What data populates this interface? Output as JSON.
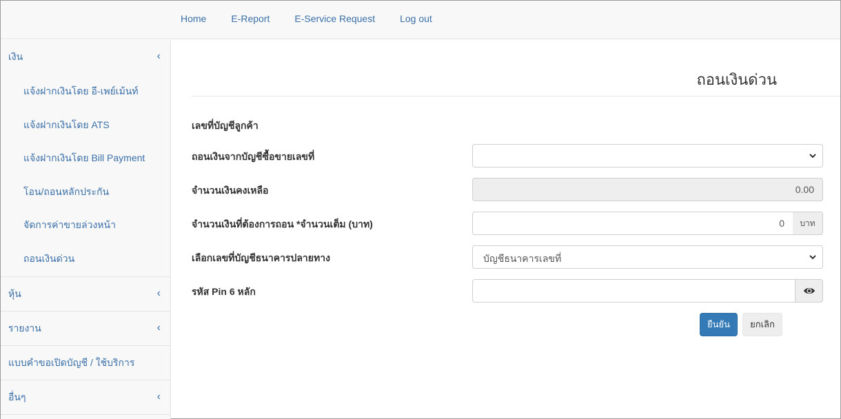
{
  "topnav": {
    "items": [
      "Home",
      "E-Report",
      "E-Service Request",
      "Log out"
    ]
  },
  "sidebar": {
    "groups": [
      {
        "label": "เงิน",
        "chevron": "‹"
      },
      {
        "label": "หุ้น",
        "chevron": "‹"
      },
      {
        "label": "รายงาน",
        "chevron": "‹"
      },
      {
        "label": "แบบคำขอเปิดบัญชี / ใช้บริการ"
      },
      {
        "label": "อื่นๆ",
        "chevron": "‹"
      }
    ],
    "money_items": [
      "แจ้งฝากเงินโดย อี-เพย์เม้นท์",
      "แจ้งฝากเงินโดย ATS",
      "แจ้งฝากเงินโดย Bill Payment",
      "โอน/ถอนหลักประกัน",
      "จัดการค่าขายล่วงหน้า",
      "ถอนเงินด่วน"
    ]
  },
  "page": {
    "title": "ถอนเงินด่วน"
  },
  "form": {
    "customer_account_label": "เลขที่บัญชีลูกค้า",
    "from_account_label": "ถอนเงินจากบัญชีซื้อขายเลขที่",
    "from_account_value": "",
    "balance_label": "จำนวนเงินคงเหลือ",
    "balance_value": "0.00",
    "amount_label": "จำนวนเงินที่ต้องการถอน *จำนวนเต็ม (บาท)",
    "amount_value": "0",
    "amount_unit": "บาท",
    "bank_label": "เลือกเลขที่บัญชีธนาคารปลายทาง",
    "bank_value": "บัญชีธนาคารเลขที่",
    "pin_label": "รหัส Pin 6 หลัก",
    "pin_value": "",
    "confirm_label": "ยืนยัน",
    "cancel_label": "ยกเลิก"
  },
  "colors": {
    "link": "#3a6fa8",
    "primary_button": "#337ab7",
    "sidebar_bg": "#f8f8f8"
  },
  "icons": {
    "dropdown": "chevron-down-icon",
    "group_collapse": "chevron-left-icon",
    "show_password": "eye-icon"
  }
}
